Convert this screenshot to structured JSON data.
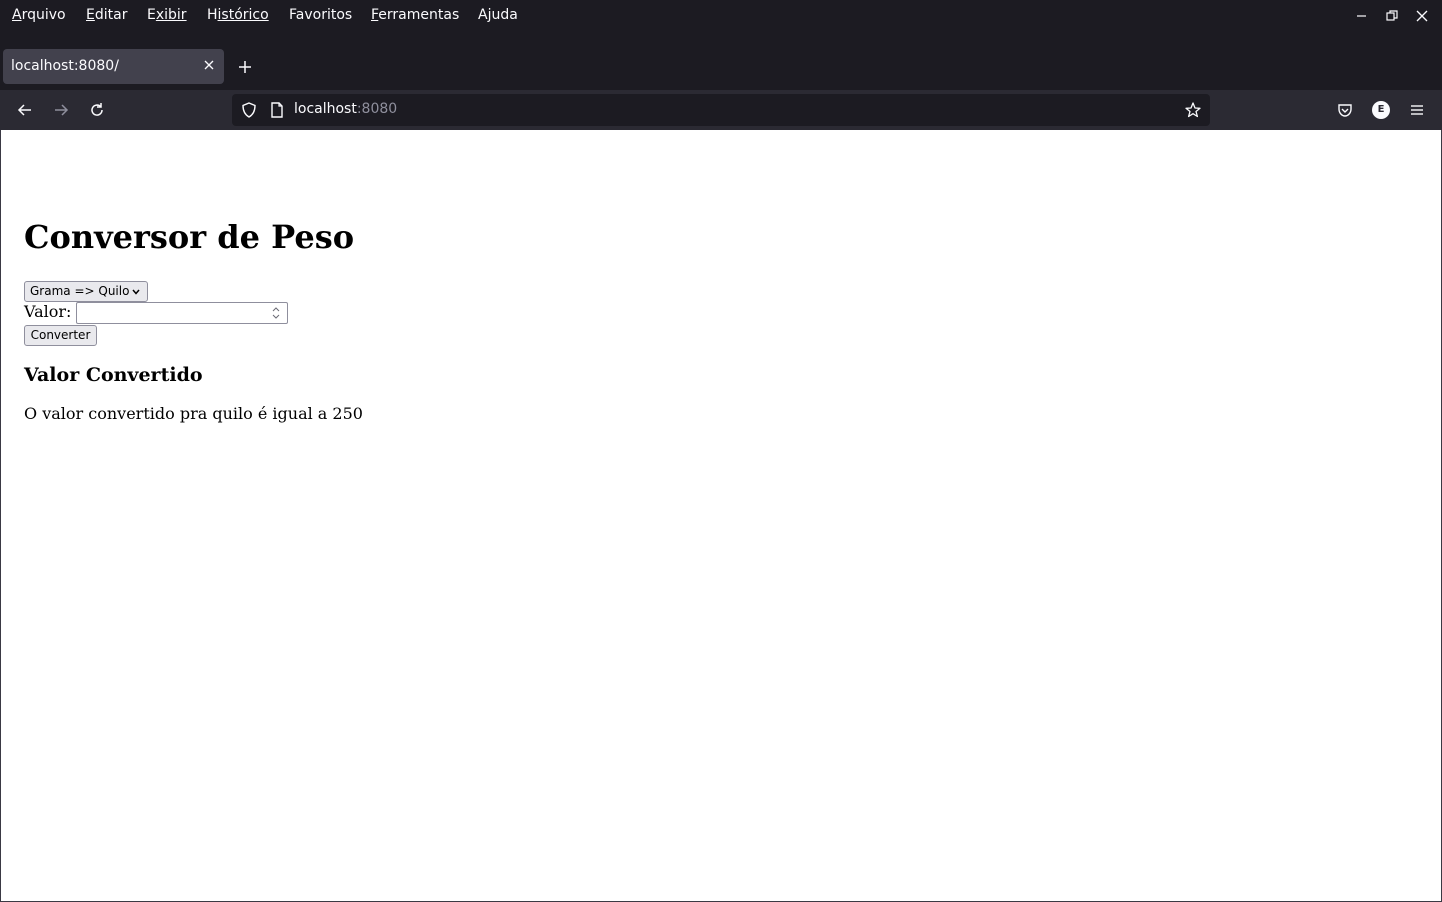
{
  "menubar": {
    "items": [
      {
        "first": "A",
        "rest": "rquivo"
      },
      {
        "first": "E",
        "rest": "ditar"
      },
      {
        "first": "E",
        "rest": "xibir"
      },
      {
        "first": "H",
        "rest": "istórico"
      },
      {
        "first": "F",
        "rest": "avoritos"
      },
      {
        "first": "F",
        "rest": "erramentas"
      },
      {
        "first": "A",
        "rest": "juda"
      }
    ]
  },
  "tab": {
    "title": "localhost:8080/"
  },
  "urlbar": {
    "host": "localhost",
    "port": ":8080"
  },
  "account": {
    "initial": "E"
  },
  "page": {
    "title": "Conversor de Peso",
    "select_value": "Grama => Quilo",
    "valor_label": "Valor:",
    "valor_value": "",
    "button_label": "Converter",
    "result_heading": "Valor Convertido",
    "result_text": "O valor convertido pra quilo é igual a 250"
  },
  "colors": {
    "chrome_dark": "#1c1b22",
    "toolbar": "#2b2a33",
    "tab_active": "#42414d",
    "text_light": "#fbfbfe"
  }
}
